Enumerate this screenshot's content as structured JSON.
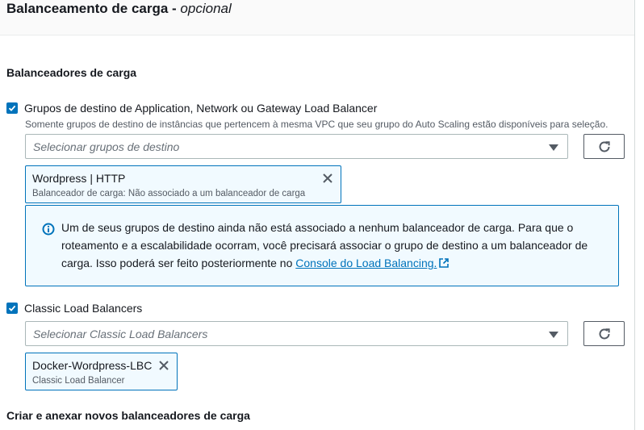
{
  "header": {
    "title": "Balanceamento de carga",
    "title_suffix": "opcional"
  },
  "load_balancers_section": {
    "title": "Balanceadores de carga"
  },
  "target_groups": {
    "checkbox_checked": true,
    "label": "Grupos de destino de Application, Network ou Gateway Load Balancer",
    "description": "Somente grupos de destino de instâncias que pertencem à mesma VPC que seu grupo do Auto Scaling estão disponíveis para seleção.",
    "select_placeholder": "Selecionar grupos de destino",
    "token": {
      "title": "Wordpress | HTTP",
      "subtitle": "Balanceador de carga: Não associado a um balanceador de carga"
    }
  },
  "alert": {
    "text": "Um de seus grupos de destino ainda não está associado a nenhum balanceador de carga. Para que o roteamento e a escalabilidade ocorram, você precisará associar o grupo de destino a um balanceador de carga. Isso poderá ser feito posteriormente no ",
    "link_label": "Console do Load Balancing."
  },
  "classic": {
    "checkbox_checked": true,
    "label": "Classic Load Balancers",
    "select_placeholder": "Selecionar Classic Load Balancers",
    "token": {
      "title": "Docker-Wordpress-LBC",
      "subtitle": "Classic Load Balancer"
    }
  },
  "create_section": {
    "title": "Criar e anexar novos balanceadores de carga"
  },
  "colors": {
    "accent": "#0073bb",
    "info_bg": "#f1faff",
    "text": "#16191f",
    "muted": "#545b64"
  },
  "icons": {
    "checkbox": "check-icon",
    "refresh": "refresh-icon",
    "remove": "close-icon",
    "info": "info-icon",
    "external": "external-link-icon",
    "dropdown": "caret-down-icon"
  }
}
